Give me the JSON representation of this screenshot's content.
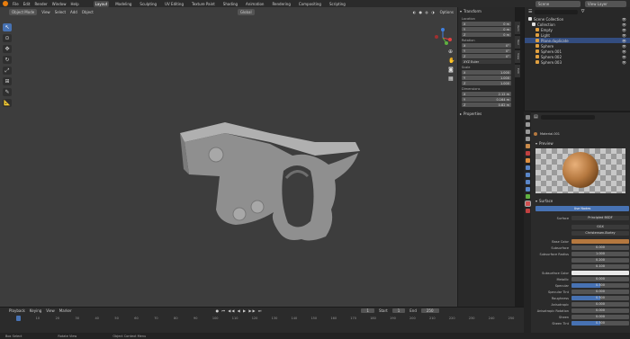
{
  "menubar": {
    "menus": [
      "File",
      "Edit",
      "Render",
      "Window",
      "Help"
    ],
    "workspaces": [
      "Layout",
      "Modeling",
      "Sculpting",
      "UV Editing",
      "Texture Paint",
      "Shading",
      "Animation",
      "Rendering",
      "Compositing",
      "Scripting"
    ],
    "active_workspace": "Layout",
    "scene": "Scene",
    "view_layer": "View Layer"
  },
  "viewport": {
    "mode": "Object Mode",
    "menus": [
      "View",
      "Select",
      "Add",
      "Object"
    ],
    "orientation": "Global",
    "options": "Options"
  },
  "npanel": {
    "transform_title": "Transform",
    "location_label": "Location",
    "location": [
      {
        "axis": "X",
        "value": "0 m"
      },
      {
        "axis": "Y",
        "value": "0 m"
      },
      {
        "axis": "Z",
        "value": "0 m"
      }
    ],
    "rotation_label": "Rotation",
    "rotation": [
      {
        "axis": "X",
        "value": "0°"
      },
      {
        "axis": "Y",
        "value": "0°"
      },
      {
        "axis": "Z",
        "value": "0°"
      }
    ],
    "rotation_mode": "XYZ Euler",
    "scale_label": "Scale",
    "scale": [
      {
        "axis": "X",
        "value": "1.000"
      },
      {
        "axis": "Y",
        "value": "1.000"
      },
      {
        "axis": "Z",
        "value": "1.000"
      }
    ],
    "dimensions_label": "Dimensions",
    "dimensions": [
      {
        "axis": "X",
        "value": "2.12 m"
      },
      {
        "axis": "Y",
        "value": "0.164 m"
      },
      {
        "axis": "Z",
        "value": "0.82 m"
      }
    ],
    "properties_title": "Properties",
    "tabs": [
      "Item",
      "Tool",
      "View",
      "Edit"
    ]
  },
  "outliner": {
    "items": [
      {
        "label": "Scene Collection",
        "selected": false,
        "color": "#e0e0e0"
      },
      {
        "label": "Collection",
        "selected": false,
        "color": "#e0e0e0"
      },
      {
        "label": "Empty",
        "selected": false,
        "color": "#e0a040"
      },
      {
        "label": "Light",
        "selected": false,
        "color": "#e0a040"
      },
      {
        "label": "Plane.duplicate",
        "selected": true,
        "color": "#e0a040"
      },
      {
        "label": "Sphere",
        "selected": false,
        "color": "#e0a040"
      },
      {
        "label": "Sphere.001",
        "selected": false,
        "color": "#e0a040"
      },
      {
        "label": "Sphere.002",
        "selected": false,
        "color": "#e0a040"
      },
      {
        "label": "Sphere.003",
        "selected": false,
        "color": "#e0a040"
      }
    ]
  },
  "properties": {
    "material": "Material.001",
    "preview_label": "Preview",
    "surface_label": "Surface",
    "use_nodes": "Use Nodes",
    "surface_row": {
      "label": "Surface",
      "value": "Principled BSDF"
    },
    "distribution": "GGX",
    "subsurface_method": "Christensen-Burley",
    "rows": [
      {
        "label": "Base Color",
        "value": "",
        "kind": "color",
        "color": "#b5783f"
      },
      {
        "label": "Subsurface",
        "value": "0.000",
        "kind": "num",
        "fill": 0
      },
      {
        "label": "Subsurface Radius",
        "value": "1.000",
        "kind": "num",
        "fill": 0
      },
      {
        "label": "",
        "value": "0.200",
        "kind": "num",
        "fill": 0
      },
      {
        "label": "",
        "value": "0.100",
        "kind": "num",
        "fill": 0
      },
      {
        "label": "Subsurface Color",
        "value": "",
        "kind": "color",
        "color": "#e8e8e8"
      },
      {
        "label": "Metallic",
        "value": "0.000",
        "kind": "num",
        "fill": 0
      },
      {
        "label": "Specular",
        "value": "0.500",
        "kind": "num",
        "fill": 0.5
      },
      {
        "label": "Specular Tint",
        "value": "0.000",
        "kind": "num",
        "fill": 0
      },
      {
        "label": "Roughness",
        "value": "0.500",
        "kind": "num",
        "fill": 0.5
      },
      {
        "label": "Anisotropic",
        "value": "0.000",
        "kind": "num",
        "fill": 0
      },
      {
        "label": "Anisotropic Rotation",
        "value": "0.000",
        "kind": "num",
        "fill": 0
      },
      {
        "label": "Sheen",
        "value": "0.000",
        "kind": "num",
        "fill": 0
      },
      {
        "label": "Sheen Tint",
        "value": "0.500",
        "kind": "num",
        "fill": 0.5
      }
    ]
  },
  "timeline": {
    "menus": [
      "Playback",
      "Keying",
      "View",
      "Marker"
    ],
    "current_frame": "1",
    "start_label": "Start",
    "start": "1",
    "end_label": "End",
    "end": "250",
    "ticks": [
      "0",
      "10",
      "20",
      "30",
      "40",
      "50",
      "60",
      "70",
      "80",
      "90",
      "100",
      "110",
      "120",
      "130",
      "140",
      "150",
      "160",
      "170",
      "180",
      "190",
      "200",
      "210",
      "220",
      "230",
      "240",
      "250"
    ]
  },
  "statusbar": {
    "items": [
      "Box Select",
      "Rotate View",
      "Object Context Menu"
    ]
  },
  "colors": {
    "accent": "#4772b3",
    "object_mesh": "#9a9a9a",
    "viewport_bg": "#3d3d3d"
  }
}
